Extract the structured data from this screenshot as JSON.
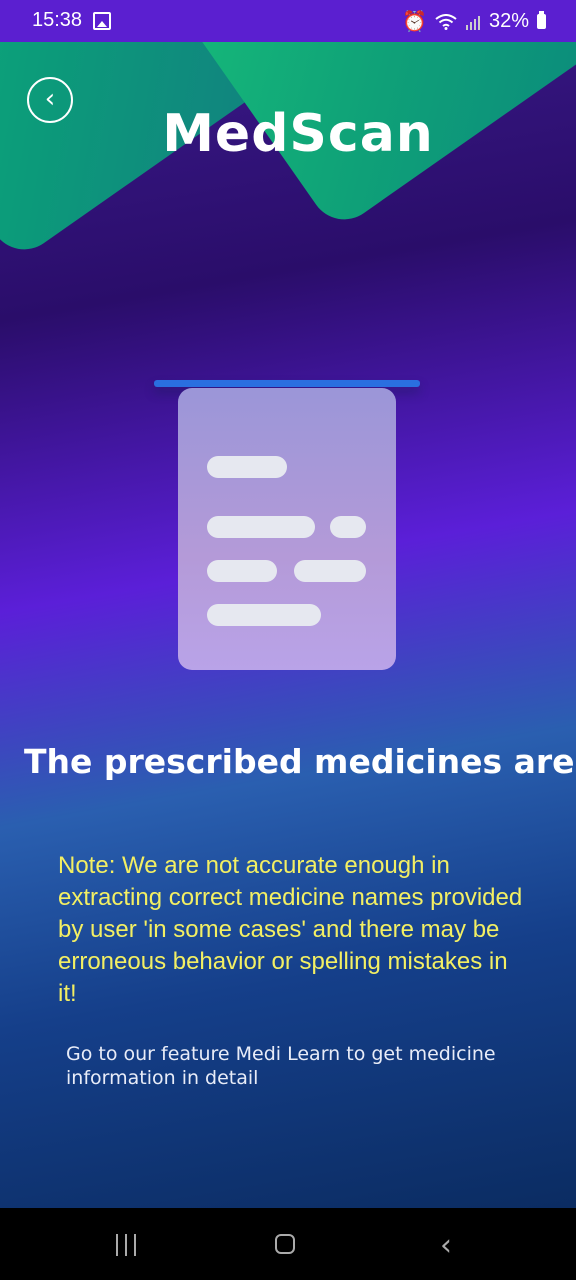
{
  "status_bar": {
    "time": "15:38",
    "battery": "32%",
    "icons": [
      "image-icon",
      "alarm-icon",
      "wifi-icon",
      "signal-icon",
      "battery-icon"
    ]
  },
  "header": {
    "back_icon": "chevron-left-icon",
    "app_title": "MedScan"
  },
  "content": {
    "heading": "The prescribed medicines are  :",
    "note": "Note: We are not accurate enough in extracting correct medicine names provided by user 'in some cases' and there may be erroneous behavior or spelling mistakes in it!",
    "info": "Go to our feature Medi Learn to get medicine information in detail"
  },
  "nav_bar": {
    "icons": [
      "recent-apps-icon",
      "home-icon",
      "back-icon"
    ]
  },
  "colors": {
    "accent_green": "#0fb57a",
    "note_yellow": "#f3ef63",
    "status_bar_purple": "#5b1fd0"
  }
}
